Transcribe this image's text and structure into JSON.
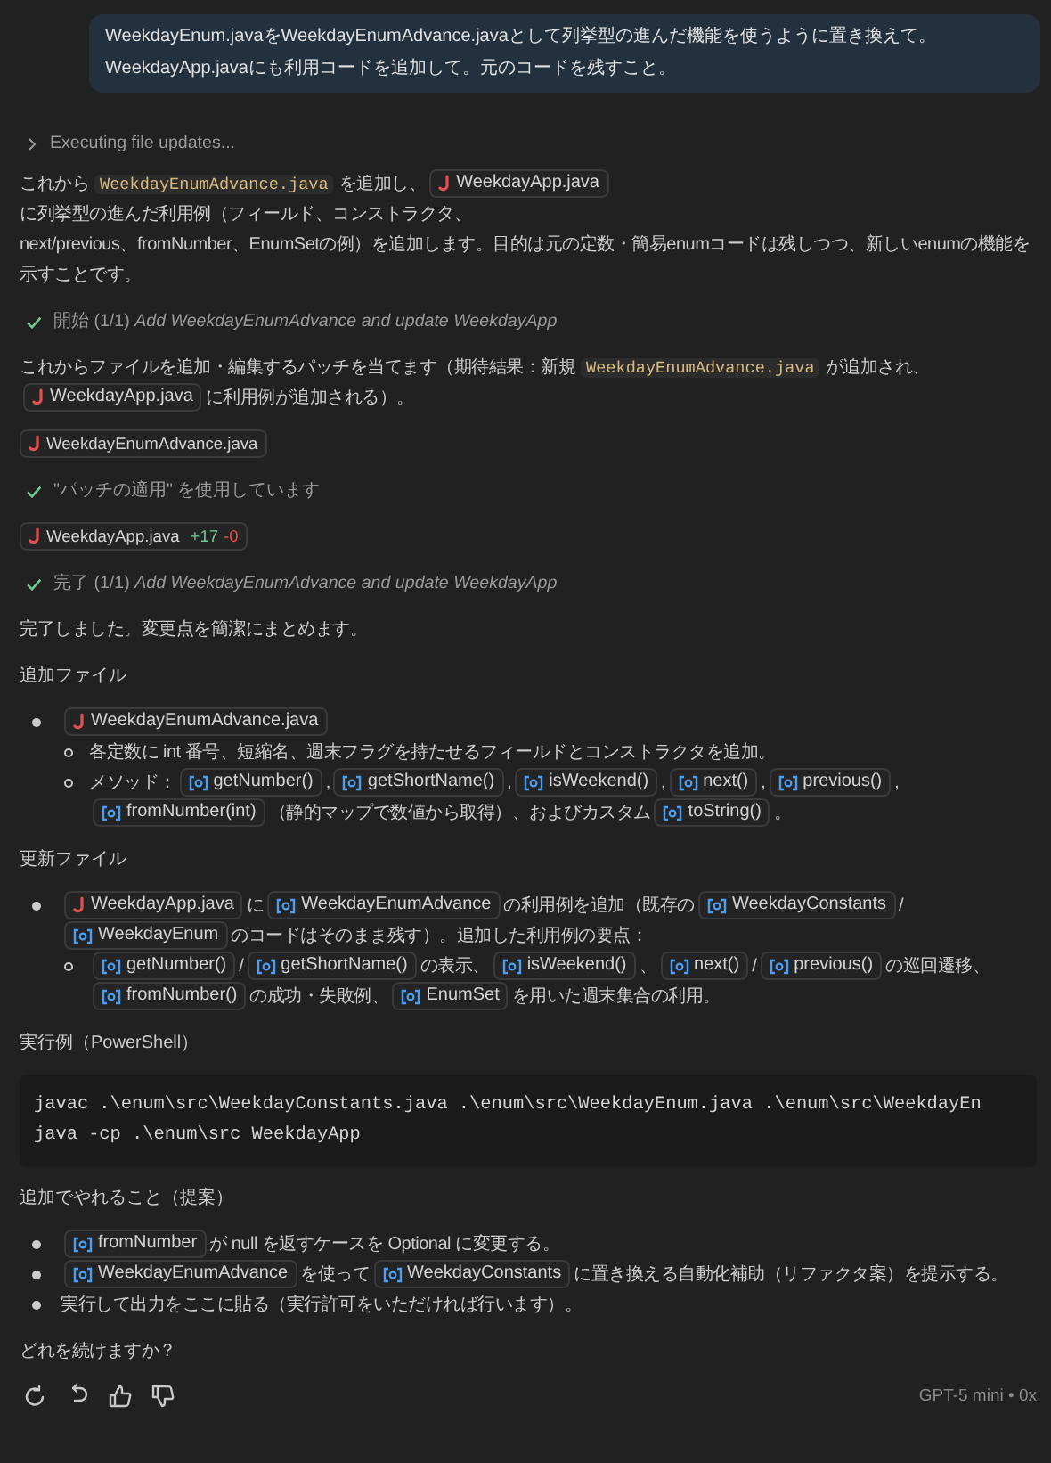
{
  "user_message": {
    "lines": [
      "WeekdayEnum.javaをWeekdayEnumAdvance.javaとして列挙型の進んだ機能を使うように置き換えて。",
      "WeekdayApp.javaにも利用コードを追加して。元のコードを残すこと。"
    ]
  },
  "progress": {
    "label": "Executing file updates...",
    "expanded": false
  },
  "blocks": [
    {
      "kind": "paragraph",
      "segments": [
        {
          "kind": "text",
          "text": "これから"
        },
        {
          "kind": "code",
          "text": "WeekdayEnumAdvance.java"
        },
        {
          "kind": "text",
          "text": "を追加し、"
        },
        {
          "kind": "file",
          "text": "WeekdayApp.java"
        },
        {
          "kind": "text",
          "text": "に列挙型の進んだ利用例（フィールド、コンストラクタ、"
        },
        {
          "kind": "text",
          "text": "next/previous、fromNumber、EnumSetの例）を追加します。目的は元の定数・簡易enumコードは残しつつ、新しいenumの機能を"
        },
        {
          "kind": "text",
          "text": "示すことです。"
        }
      ]
    },
    {
      "kind": "status",
      "text": "開始 (1/1) *Add WeekdayEnumAdvance and update WeekdayApp*"
    },
    {
      "kind": "paragraph",
      "segments": [
        {
          "kind": "text",
          "text": "これからファイルを追加・編集するパッチを当てます（期待結果：新規"
        },
        {
          "kind": "code",
          "text": "WeekdayEnumAdvance.java"
        },
        {
          "kind": "text",
          "text": "が追加され、"
        },
        {
          "kind": "file",
          "text": "WeekdayApp.java"
        },
        {
          "kind": "text",
          "text": "に利用例が追加される）。"
        }
      ]
    },
    {
      "kind": "file_chip",
      "text": "WeekdayEnumAdvance.java"
    },
    {
      "kind": "status",
      "text": "\"パッチの適用\" を使用しています"
    },
    {
      "kind": "file_chip",
      "text": "WeekdayApp.java",
      "added": "+17",
      "removed": "-0"
    },
    {
      "kind": "status",
      "text": "完了 (1/1) *Add WeekdayEnumAdvance and update WeekdayApp*"
    },
    {
      "kind": "paragraph",
      "segments": [
        {
          "kind": "text",
          "text": "完了しました。変更点を簡潔にまとめます。"
        }
      ]
    },
    {
      "kind": "heading",
      "text": "追加ファイル"
    },
    {
      "kind": "list",
      "items": [
        {
          "segments": [
            {
              "kind": "file",
              "text": "WeekdayEnumAdvance.java"
            }
          ],
          "children": [
            {
              "segments": [
                {
                  "kind": "text",
                  "text": "各定数に int 番号、短縮名、週末フラグを持たせるフィールドとコンストラクタを追加。"
                }
              ]
            },
            {
              "segments": [
                {
                  "kind": "text",
                  "text": "メソッド："
                },
                {
                  "kind": "symbol",
                  "text": "getNumber()"
                },
                {
                  "kind": "text",
                  "text": ","
                },
                {
                  "kind": "symbol",
                  "text": "getShortName()"
                },
                {
                  "kind": "text",
                  "text": ","
                },
                {
                  "kind": "symbol",
                  "text": "isWeekend()"
                },
                {
                  "kind": "text",
                  "text": ","
                },
                {
                  "kind": "symbol",
                  "text": "next()"
                },
                {
                  "kind": "text",
                  "text": ","
                },
                {
                  "kind": "symbol",
                  "text": "previous()"
                },
                {
                  "kind": "text",
                  "text": ","
                },
                {
                  "kind": "symbol",
                  "text": "fromNumber(int)"
                },
                {
                  "kind": "text",
                  "text": "（静的マップで数値から取得）、およびカスタム"
                },
                {
                  "kind": "symbol",
                  "text": "toString()"
                },
                {
                  "kind": "text",
                  "text": "。"
                }
              ]
            }
          ]
        }
      ]
    },
    {
      "kind": "heading",
      "text": "更新ファイル"
    },
    {
      "kind": "list",
      "items": [
        {
          "segments": [
            {
              "kind": "file",
              "text": "WeekdayApp.java"
            },
            {
              "kind": "text",
              "text": "に"
            },
            {
              "kind": "symbol",
              "text": "WeekdayEnumAdvance"
            },
            {
              "kind": "text",
              "text": "の利用例を追加（既存の"
            },
            {
              "kind": "symbol",
              "text": "WeekdayConstants"
            },
            {
              "kind": "text",
              "text": "/"
            },
            {
              "kind": "symbol",
              "text": "WeekdayEnum"
            },
            {
              "kind": "text",
              "text": "のコードはそのまま残す）。追加した利用例の要点："
            }
          ],
          "children": [
            {
              "segments": [
                {
                  "kind": "symbol",
                  "text": "getNumber()"
                },
                {
                  "kind": "text",
                  "text": "/"
                },
                {
                  "kind": "symbol",
                  "text": "getShortName()"
                },
                {
                  "kind": "text",
                  "text": "の表示、"
                },
                {
                  "kind": "symbol",
                  "text": "isWeekend()"
                },
                {
                  "kind": "text",
                  "text": "、"
                },
                {
                  "kind": "symbol",
                  "text": "next()"
                },
                {
                  "kind": "text",
                  "text": "/"
                },
                {
                  "kind": "symbol",
                  "text": "previous()"
                },
                {
                  "kind": "text",
                  "text": "の巡回遷"
                },
                {
                  "kind": "text",
                  "text": "移、"
                },
                {
                  "kind": "symbol",
                  "text": "fromNumber()"
                },
                {
                  "kind": "text",
                  "text": "の成功・失敗例、"
                },
                {
                  "kind": "symbol",
                  "text": "EnumSet"
                },
                {
                  "kind": "text",
                  "text": "を用いた週末集合の利用。"
                }
              ]
            }
          ]
        }
      ]
    },
    {
      "kind": "heading",
      "text": "実行例（PowerShell）"
    },
    {
      "kind": "code_block",
      "lines": [
        "javac .\\enum\\src\\WeekdayConstants.java .\\enum\\src\\WeekdayEnum.java .\\enum\\src\\WeekdayEn",
        "java -cp .\\enum\\src WeekdayApp"
      ]
    },
    {
      "kind": "heading",
      "text": "追加でやれること（提案）"
    },
    {
      "kind": "list",
      "items": [
        {
          "segments": [
            {
              "kind": "symbol",
              "text": "fromNumber"
            },
            {
              "kind": "text",
              "text": "が null を返すケースを Optional に変更する。"
            }
          ]
        },
        {
          "segments": [
            {
              "kind": "symbol",
              "text": "WeekdayEnumAdvance"
            },
            {
              "kind": "text",
              "text": "を使って"
            },
            {
              "kind": "symbol",
              "text": "WeekdayConstants"
            },
            {
              "kind": "text",
              "text": "に置き換える自動化補助（リファクタ案）を提示する。"
            }
          ]
        },
        {
          "segments": [
            {
              "kind": "text",
              "text": "実行して出力をここに貼る（実行許可をいただければ行います）。"
            }
          ]
        }
      ]
    },
    {
      "kind": "paragraph",
      "segments": [
        {
          "kind": "text",
          "text": "どれを続けますか？"
        }
      ]
    }
  ],
  "footer": {
    "model": "GPT-5 mini • 0x"
  }
}
